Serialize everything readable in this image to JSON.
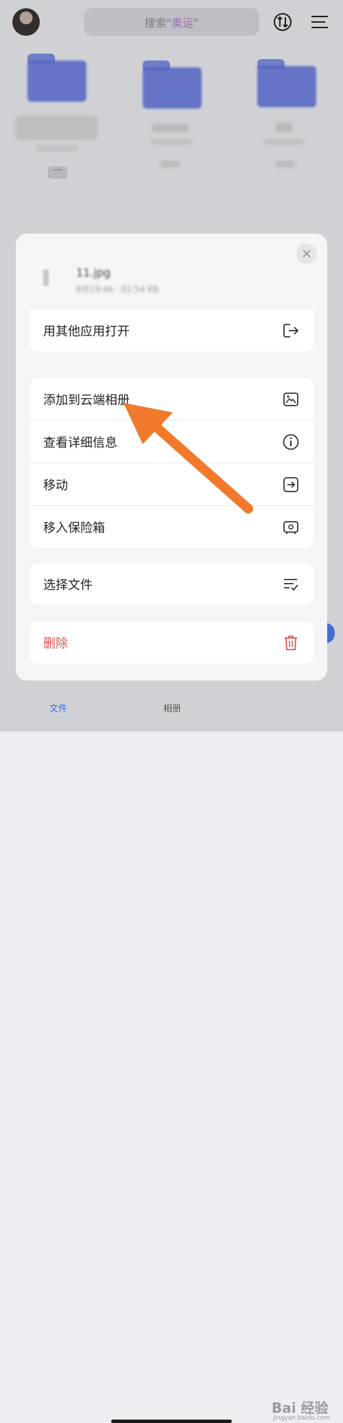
{
  "header": {
    "search_prefix": "搜索\"",
    "search_keyword": "奥运",
    "search_suffix": "\"",
    "transfer_icon": "transfer-icon",
    "menu_icon": "menu-icon"
  },
  "sheet": {
    "file_name": "11.jpg",
    "file_meta": "8月19:46 · 02:54 KB",
    "close_icon": "close-icon",
    "groups": [
      {
        "items": [
          {
            "label": "用其他应用打开",
            "icon": "share-out-icon"
          }
        ]
      },
      {
        "items": [
          {
            "label": "添加到云端相册",
            "icon": "cloud-album-icon"
          },
          {
            "label": "查看详细信息",
            "icon": "info-icon"
          },
          {
            "label": "移动",
            "icon": "move-icon"
          },
          {
            "label": "移入保险箱",
            "icon": "safe-icon"
          }
        ]
      },
      {
        "items": [
          {
            "label": "选择文件",
            "icon": "select-list-icon"
          }
        ]
      },
      {
        "items": [
          {
            "label": "删除",
            "icon": "trash-icon",
            "color": "#d7574f"
          }
        ]
      }
    ]
  },
  "tabbar": {
    "tabs": [
      {
        "label": "文件",
        "active": true
      },
      {
        "label": "相册"
      }
    ]
  },
  "watermark": {
    "text": "Bai 经验",
    "url": "jingyan.baidu.com"
  },
  "colors": {
    "accent": "#3a6df0",
    "danger": "#d7574f",
    "arrow": "#f07a2a"
  }
}
